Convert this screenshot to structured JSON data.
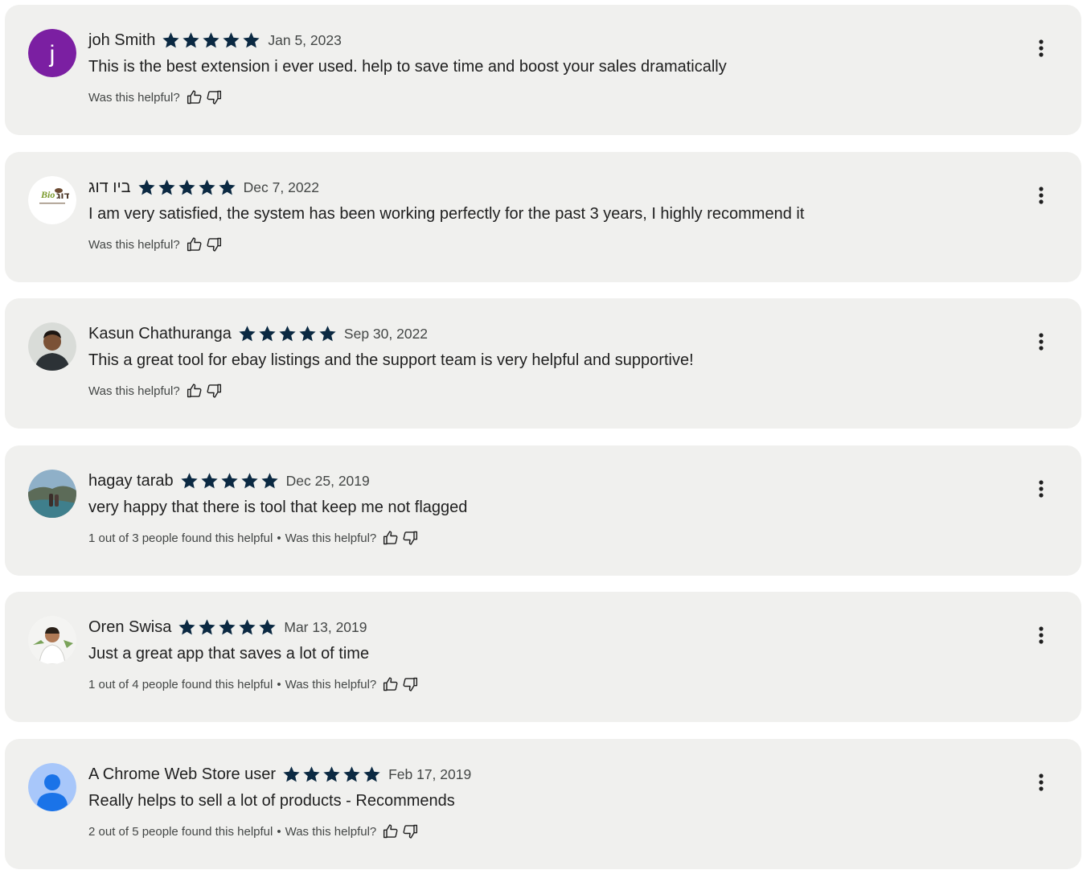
{
  "colors": {
    "card_background": "#f0f0ee",
    "star": "#0b2942",
    "text_primary": "#1f1f1f",
    "text_secondary": "#444746",
    "avatar_purple": "#7b1fa2",
    "avatar_default_bg": "#a8c7fa",
    "avatar_default_fg": "#1a73e8"
  },
  "reviews": [
    {
      "author": "joh Smith",
      "avatar_letter": "j",
      "rating": 5,
      "date": "Jan 5, 2023",
      "text": "This is the best extension i ever used. help to save time and boost your sales dramatically",
      "helpful_count": "",
      "helpful_prompt": "Was this helpful?"
    },
    {
      "author": "ביו דוג",
      "avatar_logo_text": "Bio דוג",
      "rating": 5,
      "date": "Dec 7, 2022",
      "text": "I am very satisfied, the system has been working perfectly for the past 3 years, I highly recommend it",
      "helpful_count": "",
      "helpful_prompt": "Was this helpful?"
    },
    {
      "author": "Kasun Chathuranga",
      "rating": 5,
      "date": "Sep 30, 2022",
      "text": "This a great tool for ebay listings and the support team is very helpful and supportive!",
      "helpful_count": "",
      "helpful_prompt": "Was this helpful?"
    },
    {
      "author": "hagay tarab",
      "rating": 5,
      "date": "Dec 25, 2019",
      "text": "very happy that there is tool that keep me not flagged",
      "helpful_count": "1 out of 3 people found this helpful",
      "helpful_prompt": "Was this helpful?"
    },
    {
      "author": "Oren Swisa",
      "rating": 5,
      "date": "Mar 13, 2019",
      "text": "Just a great app that saves a lot of time",
      "helpful_count": "1 out of 4 people found this helpful",
      "helpful_prompt": "Was this helpful?"
    },
    {
      "author": "A Chrome Web Store user",
      "rating": 5,
      "date": "Feb 17, 2019",
      "text": "Really helps to sell a lot of products - Recommends",
      "helpful_count": "2 out of 5 people found this helpful",
      "helpful_prompt": "Was this helpful?"
    }
  ]
}
